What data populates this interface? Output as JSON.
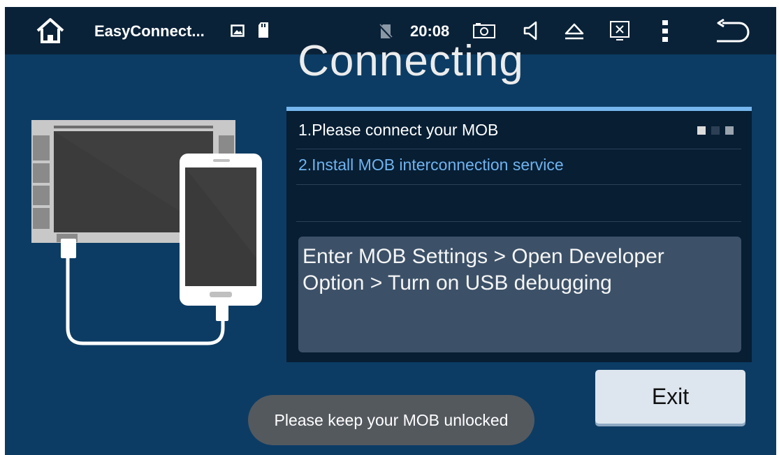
{
  "status_bar": {
    "app_title": "EasyConnect...",
    "time": "20:08",
    "icons": [
      "home-icon",
      "image-icon",
      "sd-card-icon",
      "no-sim-icon",
      "screenshot-icon",
      "volume-icon",
      "eject-icon",
      "close-window-icon",
      "more-icon",
      "back-icon"
    ]
  },
  "main": {
    "heading": "Connecting",
    "steps": [
      {
        "label": "1.Please connect your MOB",
        "color": "#ffffff"
      },
      {
        "label": "2.Install MOB interconnection service",
        "color": "#6fb3ef"
      }
    ],
    "progress_dots": [
      "#dcdcdc",
      "#2c3f55",
      "#9aa4ae"
    ],
    "instruction": "Enter MOB Settings > Open Developer Option > Turn on USB debugging",
    "exit_label": "Exit",
    "toast": "Please keep your MOB unlocked"
  },
  "colors": {
    "background": "#0c3c64",
    "status_bar": "#0a2238",
    "panel": "#071e33",
    "panel_accent": "#76b6ee",
    "instruction_box": "#3c5168"
  }
}
